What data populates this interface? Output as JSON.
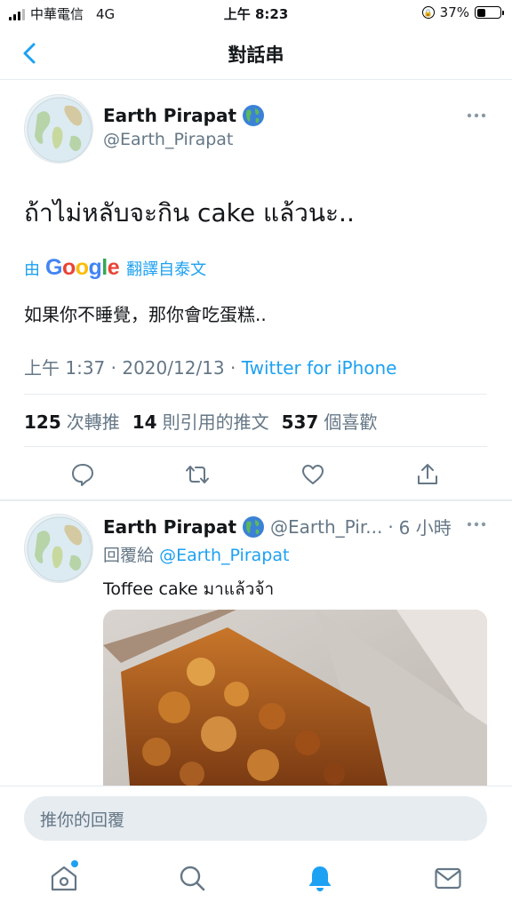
{
  "status_bar": {
    "carrier": "中華電信",
    "network": "4G",
    "time": "上午 8:23",
    "battery": "37%",
    "battery_level": 0.37
  },
  "header": {
    "title": "對話串",
    "back_icon": "chevron-left-icon"
  },
  "main_tweet": {
    "name": "Earth Pirapat",
    "handle": "@Earth_Pirapat",
    "text": "ถ้าไม่หลับจะกิน cake แล้วนะ..",
    "translate_by": "由",
    "translate_brand": [
      "G",
      "o",
      "o",
      "g",
      "l",
      "e"
    ],
    "translate_label": "翻譯自泰文",
    "translated_text": "如果你不睡覺，那你會吃蛋糕..",
    "time": "上午 1:37",
    "date": "2020/12/13",
    "source": "Twitter for iPhone",
    "meta_sep": "·",
    "stats": {
      "retweets": "125",
      "retweets_label": "次轉推",
      "quotes": "14",
      "quotes_label": "則引用的推文",
      "likes": "537",
      "likes_label": "個喜歡"
    }
  },
  "reply_tweet": {
    "name": "Earth Pirapat",
    "handle": "@Earth_Pir...",
    "time_sep": "·",
    "time": "6 小時",
    "replying_label": "回覆給",
    "replying_to": "@Earth_Pirapat",
    "text": "Toffee cake มาแล้วจ้า"
  },
  "composer": {
    "placeholder": "推你的回覆"
  },
  "tabbar": {
    "items": [
      "home-icon",
      "search-icon",
      "notifications-icon",
      "messages-icon"
    ],
    "active": "notifications-icon"
  },
  "colors": {
    "accent": "#1da1f2",
    "secondary_text": "#657786",
    "divider": "#e6ecf0"
  }
}
